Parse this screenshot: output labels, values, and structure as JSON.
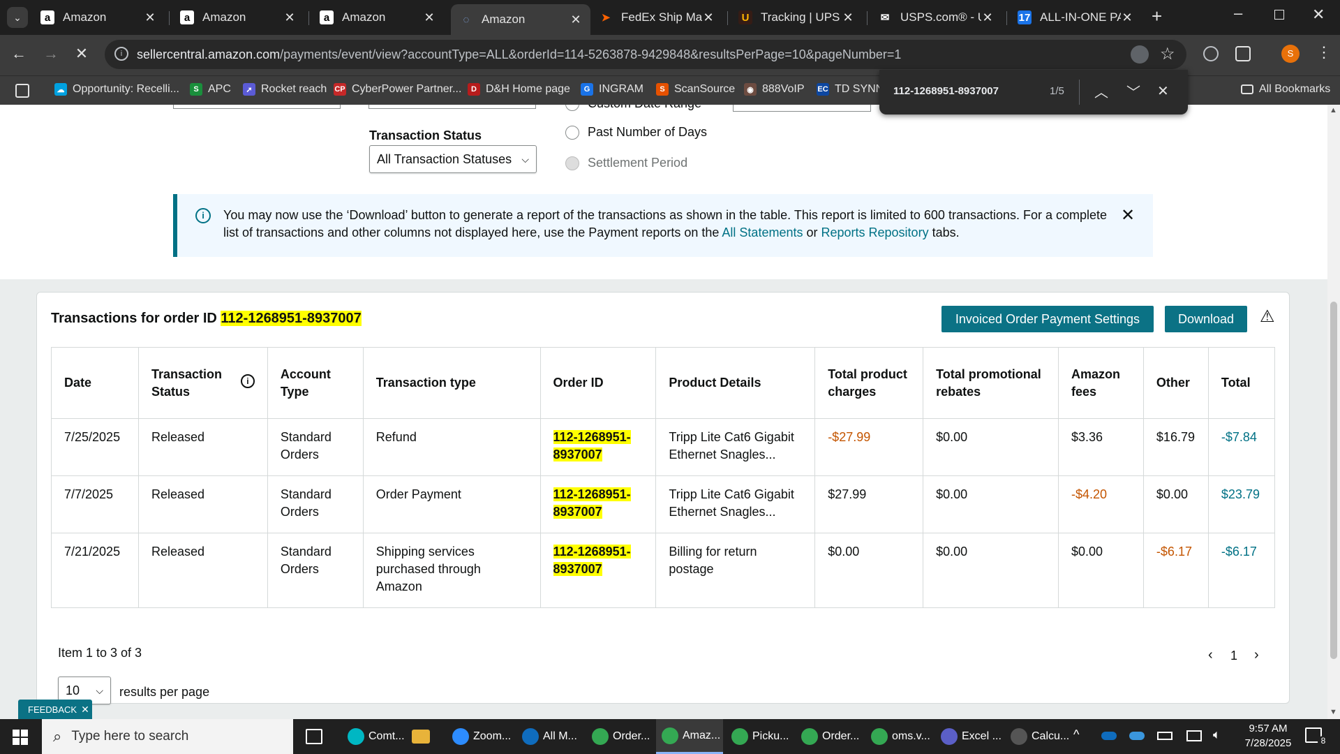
{
  "browser": {
    "tabs": [
      {
        "title": "Amazon",
        "icon": "amazon-icon"
      },
      {
        "title": "Amazon",
        "icon": "amazon-icon"
      },
      {
        "title": "Amazon",
        "icon": "amazon-icon"
      },
      {
        "title": "Amazon",
        "icon": "loading-icon"
      },
      {
        "title": "FedEx Ship Mana",
        "icon": "fedex-icon"
      },
      {
        "title": "Tracking | UPS - U",
        "icon": "ups-icon"
      },
      {
        "title": "USPS.com® - US",
        "icon": "usps-icon"
      },
      {
        "title": "ALL-IN-ONE PAC",
        "icon": "17track-icon"
      }
    ],
    "url_host": "sellercentral.amazon.com",
    "url_path": "/payments/event/view?accountType=ALL&orderId=114-5263878-9429848&resultsPerPage=10&pageNumber=1",
    "profile_initial": "S",
    "bookmarks": [
      "Opportunity: Recelli...",
      "APC",
      "Rocket reach",
      "CyberPower Partner...",
      "D&H Home page",
      "INGRAM",
      "ScanSource",
      "888VoIP",
      "TD SYNN"
    ],
    "all_bookmarks": "All Bookmarks"
  },
  "find": {
    "query": "112-1268951-8937007",
    "count": "1/5"
  },
  "filters": {
    "transaction_status_label": "Transaction Status",
    "transaction_status_value": "All Transaction Statuses",
    "radio_partial": "Custom Date Range",
    "radio_past_days": "Past Number of Days",
    "radio_settlement": "Settlement Period"
  },
  "alert": {
    "text": "You may now use the ‘Download’ button to generate a report of the transactions as shown in the table. This report is limited to 600 transactions. For a complete list of transactions and other columns not displayed here, use the Payment reports on the ",
    "link1": "All Statements",
    "mid": " or ",
    "link2": "Reports Repository",
    "tail": " tabs."
  },
  "card": {
    "title_prefix": "Transactions for order ID ",
    "order_id": "112-1268951-8937007",
    "invoiced_btn": "Invoiced Order Payment Settings",
    "download_btn": "Download"
  },
  "table": {
    "headers": [
      "Date",
      "Transaction Status",
      "Account Type",
      "Transaction type",
      "Order ID",
      "Product Details",
      "Total product charges",
      "Total promotional rebates",
      "Amazon fees",
      "Other",
      "Total"
    ],
    "rows": [
      [
        "7/25/2025",
        "Released",
        "Standard Orders",
        "Refund",
        "112-1268951-8937007",
        "Tripp Lite Cat6 Gigabit Ethernet Snagles...",
        "-$27.99",
        "$0.00",
        "$3.36",
        "$16.79",
        "-$7.84"
      ],
      [
        "7/7/2025",
        "Released",
        "Standard Orders",
        "Order Payment",
        "112-1268951-8937007",
        "Tripp Lite Cat6 Gigabit Ethernet Snagles...",
        "$27.99",
        "$0.00",
        "-$4.20",
        "$0.00",
        "$23.79"
      ],
      [
        "7/21/2025",
        "Released",
        "Standard Orders",
        "Shipping services purchased through Amazon",
        "112-1268951-8937007",
        "Billing for return postage",
        "$0.00",
        "$0.00",
        "$0.00",
        "-$6.17",
        "-$6.17"
      ]
    ]
  },
  "pagination": {
    "summary": "Item 1 to 3 of 3",
    "page": "1",
    "per_page": "10",
    "per_page_label": "results per page"
  },
  "feedback": "FEEDBACK",
  "taskbar": {
    "search_placeholder": "Type here to search",
    "apps": [
      "Comt...",
      "Zoom...",
      "All M...",
      "Order...",
      "Amaz...",
      "Picku...",
      "Order...",
      "oms.v...",
      "Excel ...",
      "Calcu..."
    ],
    "time": "9:57 AM",
    "date": "7/28/2025",
    "notifications": "8"
  },
  "colors": {
    "teal": "#007185",
    "button": "#0b7285",
    "negative": "#c45500",
    "highlight": "#ffff00"
  }
}
